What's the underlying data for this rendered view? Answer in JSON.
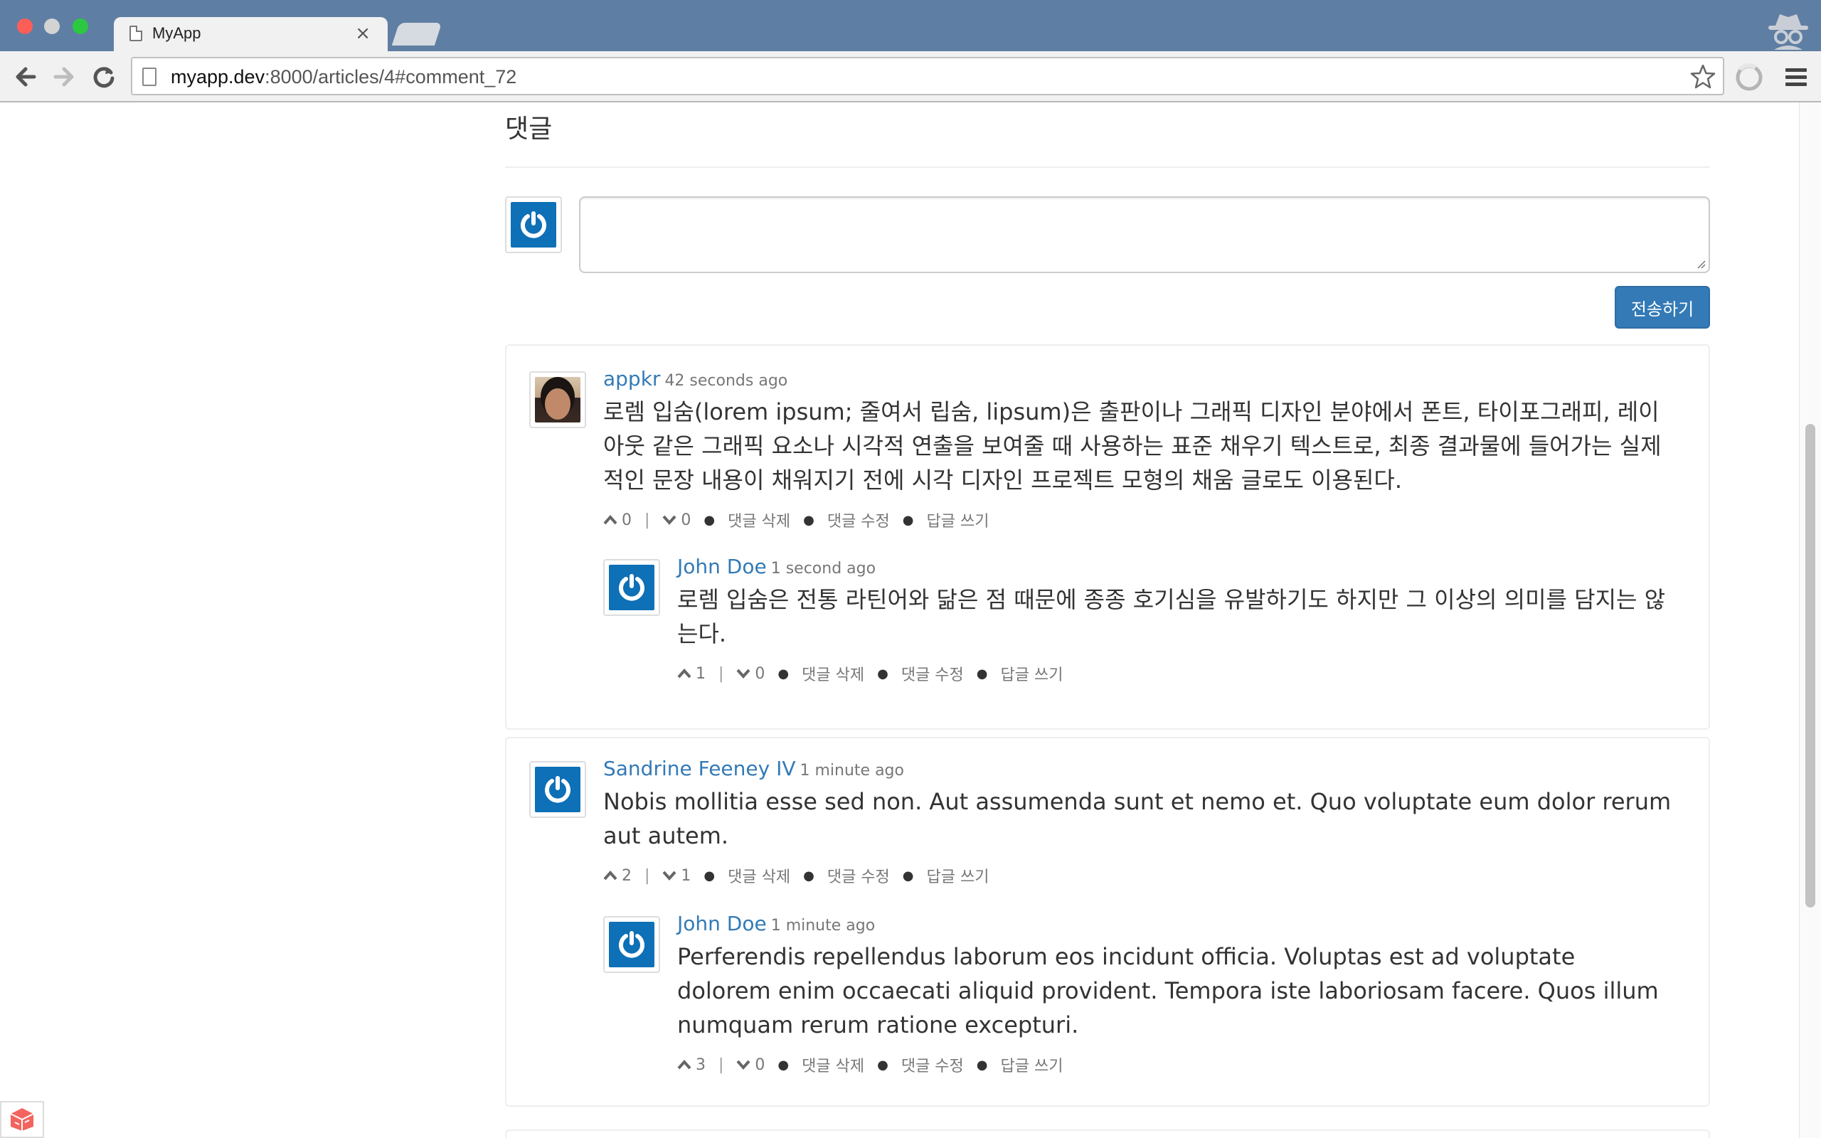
{
  "browser": {
    "tab_title": "MyApp",
    "tab_close": "×",
    "url_host": "myapp.dev",
    "url_rest": ":8000/articles/4#comment_72"
  },
  "page": {
    "section_title": "댓글",
    "textarea_placeholder": "",
    "submit_label": "전송하기",
    "action_labels": {
      "delete": "댓글 삭제",
      "edit": "댓글 수정",
      "reply": "답글 쓰기"
    },
    "threads": [
      {
        "author": "appkr",
        "time": "42 seconds ago",
        "text": "로렘 입숨(lorem ipsum; 줄여서 립숨, lipsum)은 출판이나 그래픽 디자인 분야에서 폰트, 타이포그래피, 레이아웃 같은 그래픽 요소나 시각적 연출을 보여줄 때 사용하는 표준 채우기 텍스트로, 최종 결과물에 들어가는 실제적인 문장 내용이 채워지기 전에 시각 디자인 프로젝트 모형의 채움 글로도 이용된다.",
        "up": "0",
        "down": "0",
        "avatar": "photo",
        "reply": {
          "author": "John Doe",
          "time": "1 second ago",
          "text": "로렘 입숨은 전통 라틴어와 닮은 점 때문에 종종 호기심을 유발하기도 하지만 그 이상의 의미를 담지는 않는다.",
          "up": "1",
          "down": "0",
          "avatar": "power-icon"
        }
      },
      {
        "author": "Sandrine Feeney IV",
        "time": "1 minute ago",
        "text": "Nobis mollitia esse sed non. Aut assumenda sunt et nemo et. Quo voluptate eum dolor rerum aut autem.",
        "up": "2",
        "down": "1",
        "avatar": "power-icon",
        "reply": {
          "author": "John Doe",
          "time": "1 minute ago",
          "text": "Perferendis repellendus laborum eos incidunt officia. Voluptas est ad voluptate dolorem enim occaecati aliquid provident. Tempora iste laboriosam facere. Quos illum numquam rerum ratione excepturi.",
          "up": "3",
          "down": "0",
          "avatar": "power-icon"
        }
      }
    ]
  },
  "colors": {
    "chrome_titlebar": "#5f7ea3",
    "link": "#337ab7",
    "avatar_blue": "#0e70b6",
    "button_primary": "#337ab7"
  }
}
